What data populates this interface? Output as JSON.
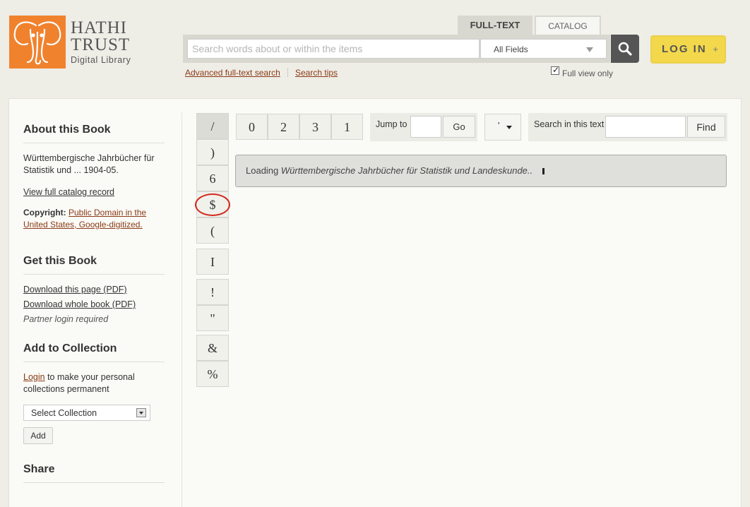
{
  "header": {
    "logo": {
      "line1": "HATHI",
      "line2": "TRUST",
      "line3": "Digital Library"
    },
    "tabs": [
      {
        "label": "FULL-TEXT"
      },
      {
        "label": "CATALOG"
      }
    ],
    "search": {
      "placeholder": "Search words about or within the items",
      "field_value": "All Fields"
    },
    "login": {
      "label": "LOG IN",
      "plus": "+"
    },
    "links": {
      "advanced": "Advanced full-text search",
      "tips": "Search tips"
    },
    "full_view": {
      "label": "Full view only",
      "checked": true
    }
  },
  "sidebar": {
    "about": {
      "heading": "About this Book",
      "title_text": "Württembergische Jahrbücher für Statistik und ... 1904-05.",
      "catalog_link": "View full catalog record",
      "copyright_label": "Copyright:",
      "copyright_link": "Public Domain in the United States, Google-digitized."
    },
    "get": {
      "heading": "Get this Book",
      "download_page": "Download this page (PDF)",
      "download_book": "Download whole book (PDF)",
      "partner_note": "Partner login required"
    },
    "collection": {
      "heading": "Add to Collection",
      "login_link": "Login",
      "login_text": " to make your personal collections permanent",
      "select_value": "Select Collection",
      "add_label": "Add"
    },
    "share": {
      "heading": "Share"
    }
  },
  "vertical_toolbar": [
    "/",
    ")",
    "6",
    "$",
    "(",
    "I",
    "!",
    "\"",
    "&",
    "%"
  ],
  "horizontal_toolbar": [
    "0",
    "2",
    "3",
    "1"
  ],
  "jump": {
    "label": "Jump to",
    "go_label": "Go"
  },
  "view_dropdown": {
    "glyph": "'"
  },
  "search_text": {
    "label": "Search in this text",
    "find_label": "Find"
  },
  "loading": {
    "prefix": "Loading ",
    "title": "Württembergische Jahrbücher für Statistik und Landeskunde..",
    "suffix": ""
  },
  "colors": {
    "brand_orange": "#f0822e",
    "login_yellow": "#f3d84b",
    "link": "#8a3a16",
    "highlight_circle": "#d42b1f"
  }
}
